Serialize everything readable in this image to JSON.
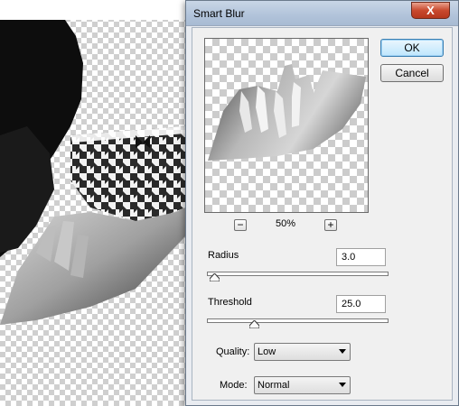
{
  "dialog": {
    "title": "Smart Blur",
    "close_label": "X"
  },
  "buttons": {
    "ok_label": "OK",
    "cancel_label": "Cancel"
  },
  "preview": {
    "zoom_level": "50%",
    "zoom_out_label": "−",
    "zoom_in_label": "+"
  },
  "radius": {
    "label": "Radius",
    "value": "3.0",
    "slider_fraction": 0.04
  },
  "threshold": {
    "label": "Threshold",
    "value": "25.0",
    "slider_fraction": 0.25
  },
  "quality": {
    "label": "Quality:",
    "selected": "Low"
  },
  "mode": {
    "label": "Mode:",
    "selected": "Normal"
  },
  "colors": {
    "title_bar": "#b1c3da",
    "close_button": "#c9492e",
    "dialog_body": "#f0f0f0",
    "default_button_border": "#3c7fb1"
  }
}
